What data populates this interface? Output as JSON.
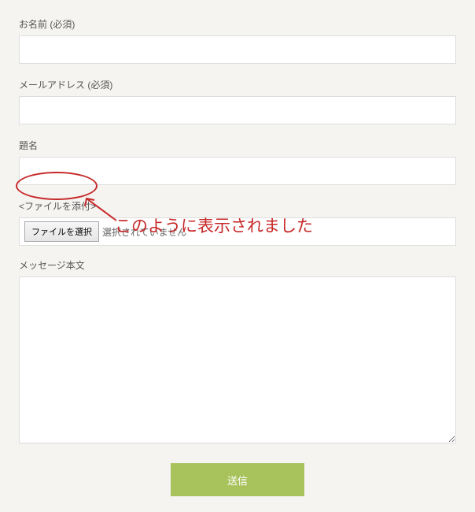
{
  "form": {
    "name_label": "お名前 (必須)",
    "email_label": "メールアドレス (必須)",
    "subject_label": "題名",
    "file_attach_label": "<ファイルを添付>",
    "file_button_label": "ファイルを選択",
    "file_status": "選択されていません",
    "message_label": "メッセージ本文",
    "submit_label": "送信"
  },
  "annotation": {
    "text": "このように表示されました"
  }
}
